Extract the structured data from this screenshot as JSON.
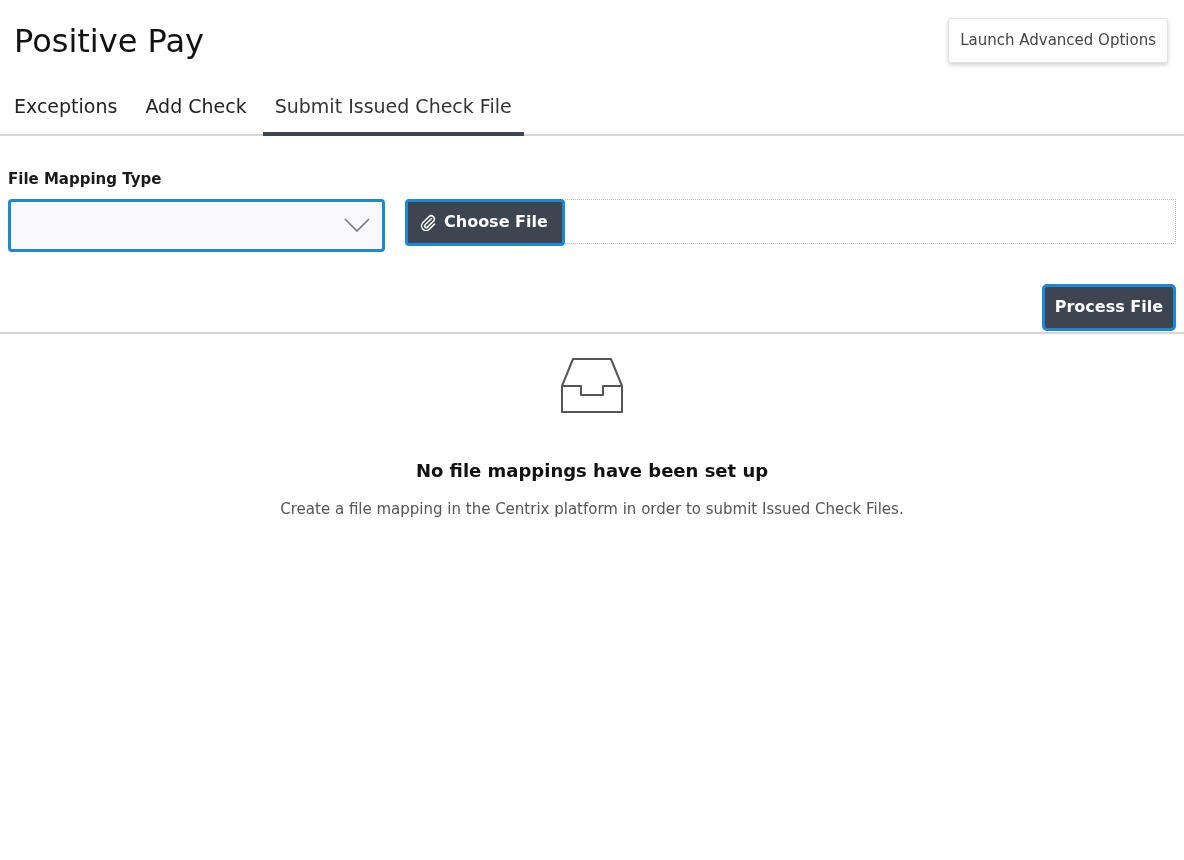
{
  "header": {
    "title": "Positive Pay",
    "action": "Launch Advanced Options"
  },
  "tabs": [
    {
      "label": "Exceptions",
      "selected": false
    },
    {
      "label": "Add Check",
      "selected": false
    },
    {
      "label": "Submit Issued Check File",
      "selected": true
    }
  ],
  "form": {
    "mapping_label": "File Mapping Type",
    "choose_button": "Choose File",
    "process_button": "Process File"
  },
  "empty_state": {
    "title": "No file mappings have been set up",
    "message": "Create a file mapping in the Centrix platform in order to submit Issued Check Files."
  }
}
